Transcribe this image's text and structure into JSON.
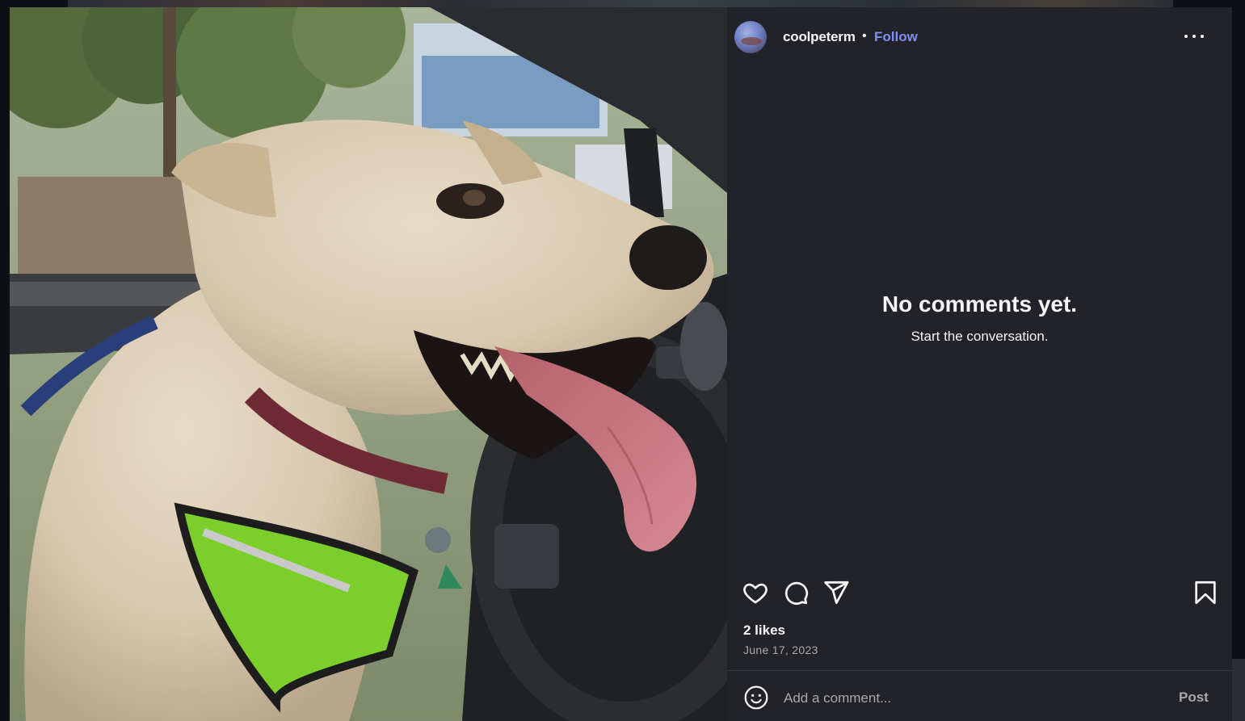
{
  "post": {
    "username": "coolpeterm",
    "separator": "•",
    "follow_label": "Follow",
    "more_icon": "more-options-icon"
  },
  "comments": {
    "empty_title": "No comments yet.",
    "empty_subtitle": "Start the conversation."
  },
  "actions": {
    "icons": [
      "heart-icon",
      "comment-icon",
      "share-icon",
      "bookmark-icon"
    ]
  },
  "stats": {
    "likes": "2 likes",
    "date": "June 17, 2023"
  },
  "composer": {
    "placeholder": "Add a comment...",
    "post_label": "Post",
    "emoji_icon": "emoji-icon"
  },
  "colors": {
    "panel_bg": "#212328",
    "accent_follow": "#7f8ff4",
    "muted_text": "#a8a8a8"
  }
}
